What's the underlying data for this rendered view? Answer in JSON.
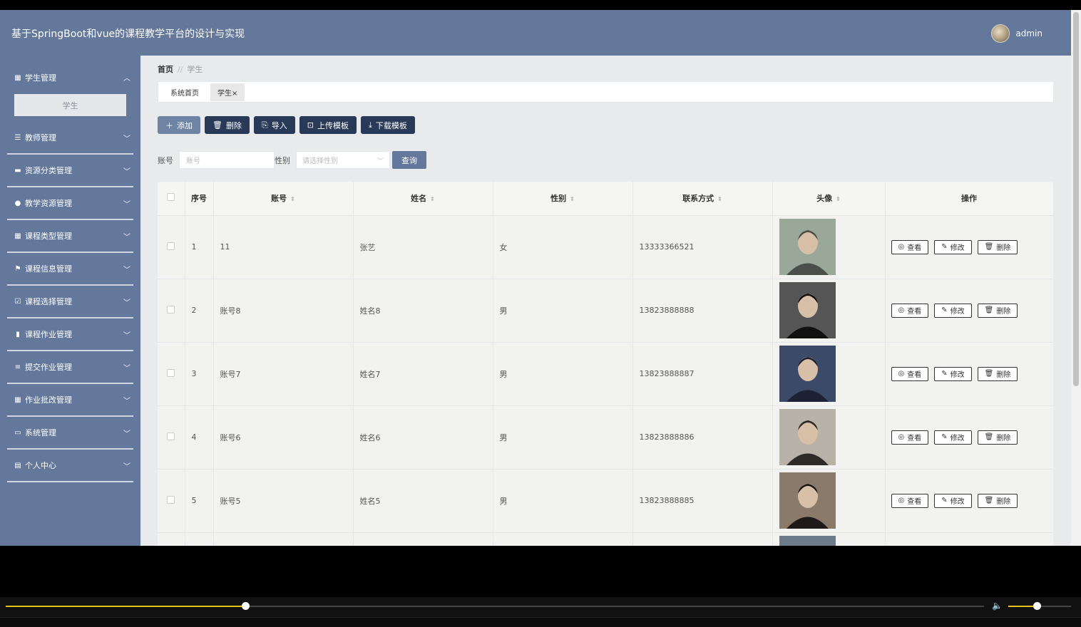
{
  "header": {
    "title": "基于SpringBoot和vue的课程教学平台的设计与实现",
    "username": "admin"
  },
  "sidebar": {
    "items": [
      {
        "label": "学生管理",
        "icon": "grid-icon",
        "glyph": "▦",
        "open": true,
        "sub": [
          "学生"
        ]
      },
      {
        "label": "教师管理",
        "icon": "sliders-icon",
        "glyph": "☰"
      },
      {
        "label": "资源分类管理",
        "icon": "ticket-icon",
        "glyph": "▬"
      },
      {
        "label": "教学资源管理",
        "icon": "bulb-icon",
        "glyph": "●"
      },
      {
        "label": "课程类型管理",
        "icon": "grid-icon",
        "glyph": "▦"
      },
      {
        "label": "课程信息管理",
        "icon": "flag-icon",
        "glyph": "⚑"
      },
      {
        "label": "课程选择管理",
        "icon": "checkbox-icon",
        "glyph": "☑"
      },
      {
        "label": "课程作业管理",
        "icon": "chart-icon",
        "glyph": "▮"
      },
      {
        "label": "提交作业管理",
        "icon": "list-icon",
        "glyph": "≡"
      },
      {
        "label": "作业批改管理",
        "icon": "grid-icon",
        "glyph": "▦"
      },
      {
        "label": "系统管理",
        "icon": "message-icon",
        "glyph": "▭"
      },
      {
        "label": "个人中心",
        "icon": "card-icon",
        "glyph": "▤"
      }
    ]
  },
  "breadcrumb": {
    "home": "首页",
    "sep": "//",
    "current": "学生"
  },
  "tabs": [
    {
      "label": "系统首页"
    },
    {
      "label": "学生",
      "close": "×"
    }
  ],
  "toolbar": {
    "add": "添加",
    "delete": "删除",
    "import": "导入",
    "upload": "上传模板",
    "download": "下载模板"
  },
  "search": {
    "account_label": "账号",
    "account_placeholder": "账号",
    "gender_label": "性别",
    "gender_placeholder": "请选择性别",
    "query": "查询"
  },
  "table": {
    "headers": {
      "index": "序号",
      "account": "账号",
      "name": "姓名",
      "gender": "性别",
      "phone": "联系方式",
      "avatar": "头像",
      "ops": "操作"
    },
    "op_labels": {
      "view": "查看",
      "edit": "修改",
      "delete": "删除"
    },
    "rows": [
      {
        "index": "1",
        "account": "11",
        "name": "张艺",
        "gender": "女",
        "phone": "13333366521"
      },
      {
        "index": "2",
        "account": "账号8",
        "name": "姓名8",
        "gender": "男",
        "phone": "13823888888"
      },
      {
        "index": "3",
        "account": "账号7",
        "name": "姓名7",
        "gender": "男",
        "phone": "13823888887"
      },
      {
        "index": "4",
        "account": "账号6",
        "name": "姓名6",
        "gender": "男",
        "phone": "13823888886"
      },
      {
        "index": "5",
        "account": "账号5",
        "name": "姓名5",
        "gender": "男",
        "phone": "13823888885"
      }
    ]
  },
  "player": {
    "progress": 0.245,
    "volume": 0.45,
    "accent": "#e7c21c"
  },
  "colors": {
    "header": "#63789a",
    "button_dark": "#283a57"
  }
}
